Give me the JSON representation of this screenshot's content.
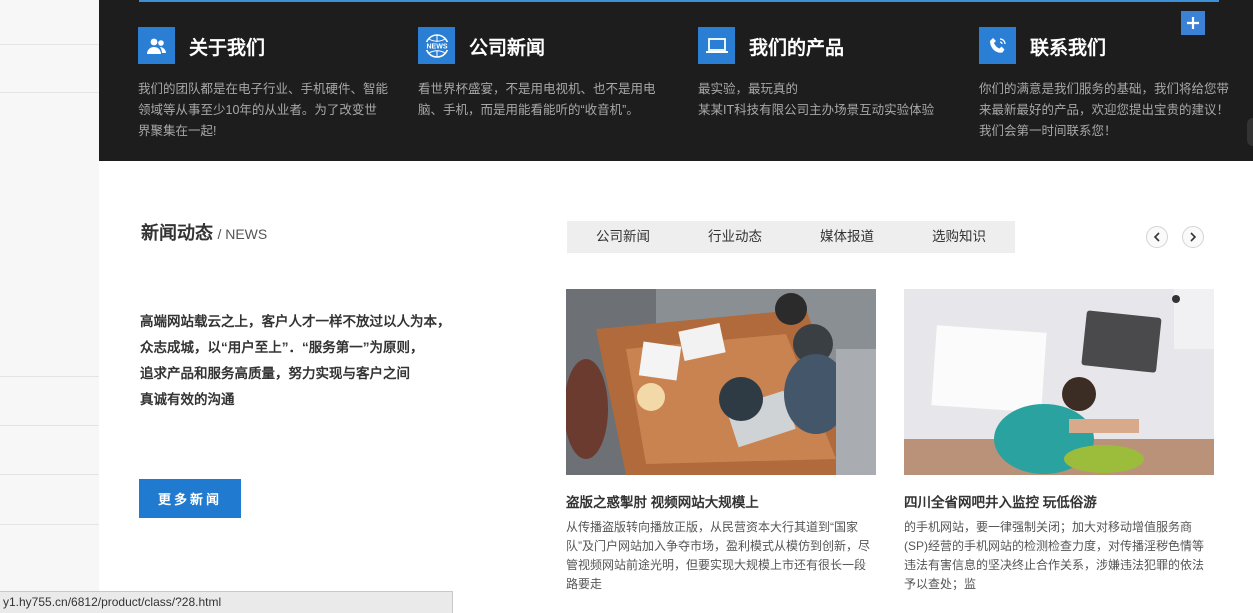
{
  "features": [
    {
      "title": "关于我们",
      "icon": "users-icon",
      "desc": "我们的团队都是在电子行业、手机硬件、智能领域等从事至少10年的从业者。为了改变世界聚集在一起!"
    },
    {
      "title": "公司新闻",
      "icon": "news-globe-icon",
      "desc": "看世界杯盛宴，不是用电视机、也不是用电脑、手机，而是用能看能听的“收音机”。"
    },
    {
      "title": "我们的产品",
      "icon": "laptop-icon",
      "desc_lines": [
        "最实验，最玩真的",
        "某某IT科技有限公司主办场景互动实验体验"
      ]
    },
    {
      "title": "联系我们",
      "icon": "phone-icon",
      "desc": "你们的满意是我们服务的基础，我们将给您带来最新最好的产品，欢迎您提出宝贵的建议！我们会第一时间联系您！"
    }
  ],
  "news_section": {
    "heading": "新闻动态",
    "heading_en": "/ NEWS",
    "intro_lines": [
      "高端网站载云之上，客户人才一样不放过以人为本，",
      "众志成城，以“用户至上”．“服务第一”为原则，",
      "追求产品和服务高质量，努力实现与客户之间",
      "真诚有效的沟通"
    ],
    "more_button": "更多新闻",
    "tabs": [
      "公司新闻",
      "行业动态",
      "媒体报道",
      "选购知识"
    ]
  },
  "articles": [
    {
      "title": "盗版之惑掣肘 视频网站大规模上",
      "desc": "从传播盗版转向播放正版，从民营资本大行其道到“国家队”及门户网站加入争夺市场，盈利模式从模仿到创新，尽管视频网站前途光明，但要实现大规模上市还有很长一段路要走"
    },
    {
      "title": "四川全省网吧井入监控 玩低俗游",
      "desc": "的手机网站，要一律强制关闭；加大对移动增值服务商(SP)经营的手机网站的检测检查力度，对传播淫秽色情等违法有害信息的坚决终止合作关系，涉嫌违法犯罪的依法予以查处；监"
    }
  ],
  "status_bar": {
    "url": "y1.hy755.cn/6812/product/class/?28.html"
  },
  "colors": {
    "accent": "#2a7fd4",
    "dark_band": "#1d1d1d",
    "button": "#1f7ad0"
  }
}
